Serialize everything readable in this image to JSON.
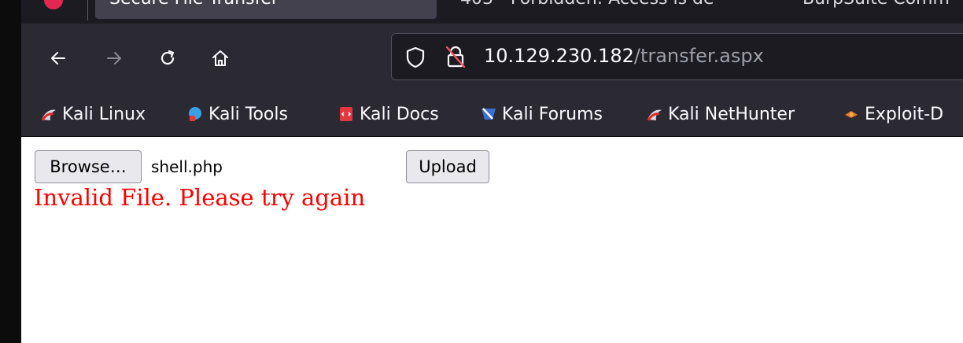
{
  "browser": {
    "tabs": [
      {
        "title": "Secure File Transfer",
        "active": true
      },
      {
        "title": "403 - Forbidden: Access is de",
        "active": false
      },
      {
        "title": "BurpSuite Comm",
        "active": false
      }
    ],
    "address_bar": {
      "host": "10.129.230.182",
      "path": "/transfer.aspx"
    },
    "icons": {
      "back": "arrow-left-icon",
      "forward": "arrow-right-icon",
      "reload": "reload-icon",
      "home": "home-icon",
      "tracking_protection": "shield-icon",
      "insecure_connection": "insecure-lock-icon"
    },
    "bookmarks": [
      {
        "label": "Kali Linux",
        "icon": "kali-dragon-icon"
      },
      {
        "label": "Kali Tools",
        "icon": "kali-tools-icon"
      },
      {
        "label": "Kali Docs",
        "icon": "kali-docs-icon"
      },
      {
        "label": "Kali Forums",
        "icon": "kali-forums-icon"
      },
      {
        "label": "Kali NetHunter",
        "icon": "kali-dragon-icon"
      },
      {
        "label": "Exploit-D",
        "icon": "exploit-db-icon"
      }
    ]
  },
  "page": {
    "browse_label": "Browse…",
    "selected_file": "shell.php",
    "upload_label": "Upload",
    "error_message": "Invalid File. Please try again"
  },
  "colors": {
    "error_text": "#ff0000",
    "toolbar_bg": "#2b2a33",
    "tab_active_bg": "#42414d",
    "accent_brand": "#e22850"
  }
}
